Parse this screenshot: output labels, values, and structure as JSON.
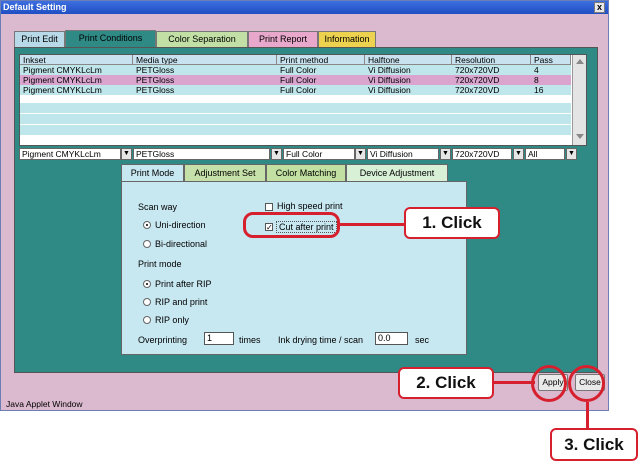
{
  "window": {
    "title": "Default Setting",
    "close_glyph": "x"
  },
  "tabs": [
    "Print Edit",
    "Print Conditions",
    "Color Separation",
    "Print Report",
    "Information"
  ],
  "grid": {
    "headers": [
      "Inkset",
      "Media type",
      "Print method",
      "Halftone",
      "Resolution",
      "Pass"
    ],
    "rows": [
      [
        "Pigment CMYKLcLm",
        "PETGloss",
        "Full Color",
        "Vi Diffusion",
        "720x720VD",
        "4"
      ],
      [
        "Pigment CMYKLcLm",
        "PETGloss",
        "Full Color",
        "Vi Diffusion",
        "720x720VD",
        "8"
      ],
      [
        "Pigment CMYKLcLm",
        "PETGloss",
        "Full Color",
        "Vi Diffusion",
        "720x720VD",
        "16"
      ]
    ],
    "selected_row": 1
  },
  "combos": [
    "Pigment CMYKLcLm",
    "PETGloss",
    "Full Color",
    "Vi Diffusion",
    "720x720VD",
    "All"
  ],
  "subtabs": [
    "Print Mode",
    "Adjustment Set",
    "Color Matching",
    "Device Adjustment"
  ],
  "print_mode": {
    "scan_way_label": "Scan way",
    "uni_label": "Uni-direction",
    "bi_label": "Bi-directional",
    "high_speed_label": "High speed print",
    "cut_after_label": "Cut after print",
    "cut_after_checked": "✓",
    "print_mode_label": "Print mode",
    "print_after_rip": "Print after RIP",
    "rip_and_print": "RIP and print",
    "rip_only": "RIP only",
    "overprinting_label": "Overprinting",
    "overprinting_value": "1",
    "times_label": "times",
    "ink_drying_label": "Ink drying time / scan",
    "ink_drying_value": "0.0",
    "sec_label": "sec"
  },
  "buttons": {
    "apply": "Apply",
    "close": "Close"
  },
  "status": "Java Applet Window",
  "callouts": {
    "one": "1. Click",
    "two": "2. Click",
    "three": "3. Click"
  },
  "colors": {
    "accent_red": "#d7202e",
    "window_bg": "#dbb9cf",
    "panel_teal": "#2f8a86",
    "row_selected": "#dba4cf"
  }
}
